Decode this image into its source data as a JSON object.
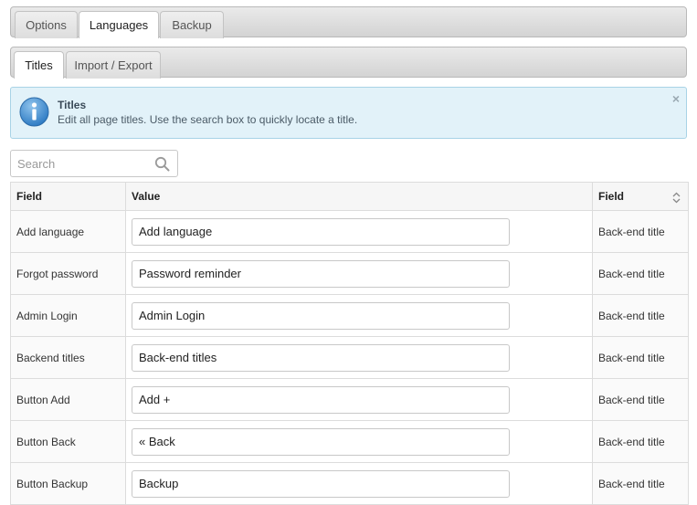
{
  "main_tabs": [
    {
      "label": "Options",
      "active": false
    },
    {
      "label": "Languages",
      "active": true
    },
    {
      "label": "Backup",
      "active": false
    }
  ],
  "sub_tabs": [
    {
      "label": "Titles",
      "active": true
    },
    {
      "label": "Import / Export",
      "active": false
    }
  ],
  "notice": {
    "title": "Titles",
    "message": "Edit all page titles. Use the search box to quickly locate a title.",
    "close": "×",
    "icon": "info-icon",
    "color": "#e2f2f9"
  },
  "search": {
    "placeholder": "Search",
    "value": "",
    "icon": "search-icon"
  },
  "table": {
    "headers": {
      "field": "Field",
      "value": "Value",
      "type": "Field"
    },
    "rows": [
      {
        "field": "Add language",
        "value": "Add language",
        "type": "Back-end title"
      },
      {
        "field": "Forgot password",
        "value": "Password reminder",
        "type": "Back-end title"
      },
      {
        "field": "Admin Login",
        "value": "Admin Login",
        "type": "Back-end title"
      },
      {
        "field": "Backend titles",
        "value": "Back-end titles",
        "type": "Back-end title"
      },
      {
        "field": "Button Add",
        "value": "Add +",
        "type": "Back-end title"
      },
      {
        "field": "Button Back",
        "value": "« Back",
        "type": "Back-end title"
      },
      {
        "field": "Button Backup",
        "value": "Backup",
        "type": "Back-end title"
      }
    ]
  }
}
